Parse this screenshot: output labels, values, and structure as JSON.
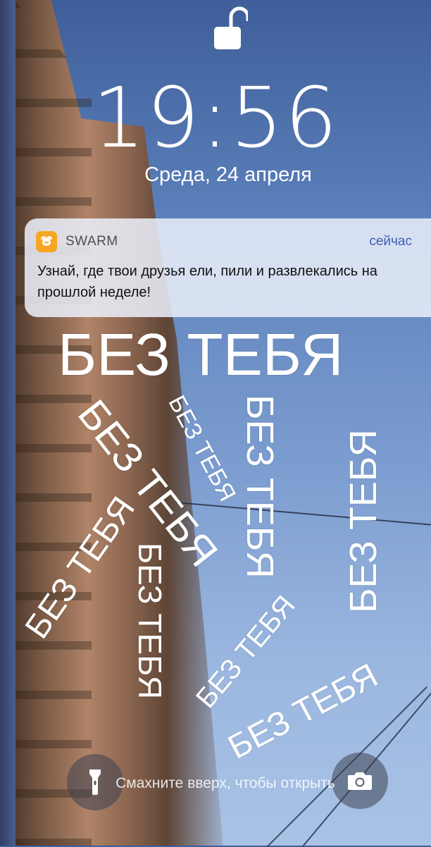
{
  "lockscreen": {
    "time": "19:56",
    "date": "Среда, 24 апреля"
  },
  "notification": {
    "app_name": "SWARM",
    "time": "сейчас",
    "body": "Узнай, где твои друзья ели, пили и развлекались на прошлой неделе!",
    "app_icon": "swarm-bee-icon",
    "accent": "#f6a623"
  },
  "stickers": [
    "БЕЗ ТЕБЯ",
    "БЕЗ ТЕБЯ",
    "БЕЗ ТЕБЯ",
    "БЕЗ ТЕБЯ",
    "БЕЗ ТЕБЯ",
    "БЕЗ ТЕБЯ",
    "БЕЗ ТЕБЯ",
    "БЕЗ ТЕБЯ",
    "БЕЗ ТЕБЯ"
  ],
  "bottom": {
    "swipe_hint": "Смахните вверх, чтобы открыть",
    "left_button_icon": "flashlight-icon",
    "right_button_icon": "camera-icon"
  }
}
